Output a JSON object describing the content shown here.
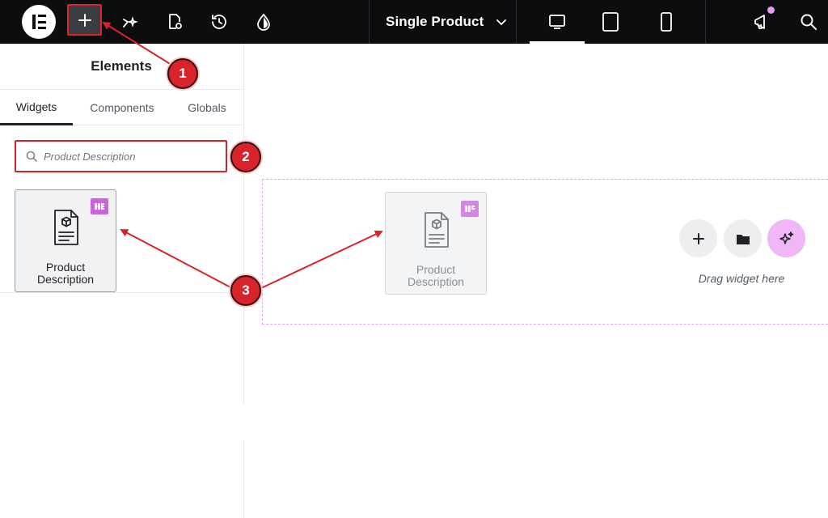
{
  "topbar": {
    "template_title": "Single Product",
    "icons": [
      "elementor-logo-icon",
      "add-element-icon",
      "sparkle-nav-icon",
      "page-settings-icon",
      "history-icon",
      "site-settings-drop-icon",
      "desktop-icon",
      "tablet-icon",
      "mobile-icon",
      "announcement-icon",
      "search-icon"
    ]
  },
  "panel": {
    "title": "Elements",
    "tabs": [
      {
        "label": "Widgets",
        "active": true
      },
      {
        "label": "Components",
        "active": false
      },
      {
        "label": "Globals",
        "active": false
      }
    ],
    "search": {
      "placeholder": "Product Description",
      "value": ""
    },
    "widget": {
      "label_line1": "Product",
      "label_line2": "Description",
      "badge_icon": "pro-badge-icon"
    }
  },
  "canvas": {
    "ghost_widget": {
      "label_line1": "Product",
      "label_line2": "Description"
    },
    "drag_text": "Drag widget here"
  },
  "annotations": {
    "badge_1": "1",
    "badge_2": "2",
    "badge_3": "3"
  },
  "colors": {
    "topbar_bg": "#0c0d0e",
    "accent_red": "#d8232a",
    "pro_purple": "#c964de",
    "ai_pink": "#f0b6f7",
    "dropzone_border": "#e2a7ea"
  }
}
